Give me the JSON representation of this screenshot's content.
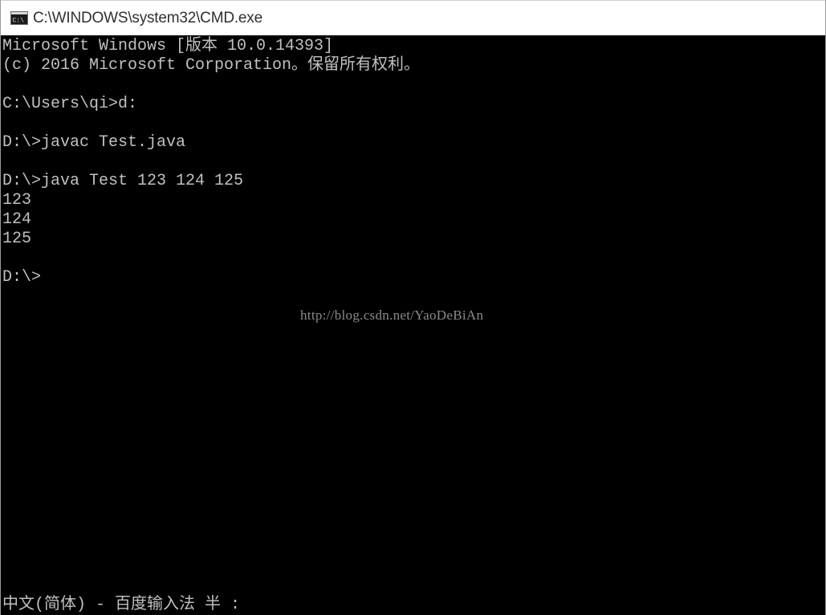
{
  "window": {
    "title": "C:\\WINDOWS\\system32\\CMD.exe",
    "icon": "cmd-icon"
  },
  "console": {
    "lines": [
      "Microsoft Windows [版本 10.0.14393]",
      "(c) 2016 Microsoft Corporation。保留所有权利。",
      "",
      "C:\\Users\\qi>d:",
      "",
      "D:\\>javac Test.java",
      "",
      "D:\\>java Test 123 124 125",
      "123",
      "124",
      "125",
      "",
      "D:\\>"
    ]
  },
  "watermark": "http://blog.csdn.net/YaoDeBiAn",
  "ime_status": "中文(简体) - 百度输入法 半 :",
  "colors": {
    "console_background": "#000000",
    "console_text": "#c0c0c0",
    "titlebar_background": "#ffffff"
  }
}
